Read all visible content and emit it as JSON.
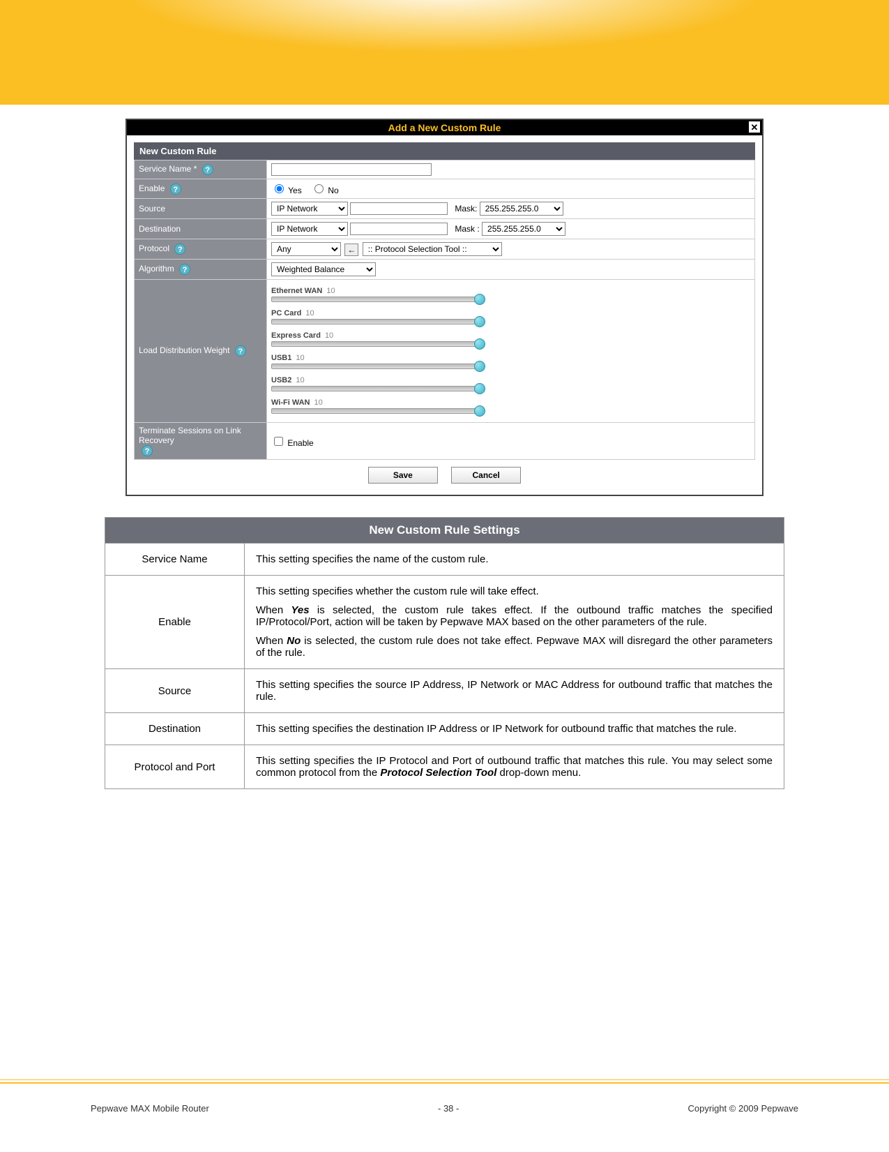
{
  "header_band": {},
  "dialog": {
    "title": "Add a New Custom Rule",
    "close_glyph": "✕",
    "section_title": "New Custom Rule",
    "rows": {
      "service_name": {
        "label": "Service Name *",
        "value": ""
      },
      "enable": {
        "label": "Enable",
        "yes": "Yes",
        "no": "No",
        "selected": "yes"
      },
      "source": {
        "label": "Source",
        "type": "IP Network",
        "addr": "",
        "mask_label": "Mask:",
        "mask": "255.255.255.0"
      },
      "destination": {
        "label": "Destination",
        "type": "IP Network",
        "addr": "",
        "mask_label": "Mask :",
        "mask": "255.255.255.0"
      },
      "protocol": {
        "label": "Protocol",
        "value": "Any",
        "arrow": "←",
        "tool": ":: Protocol Selection Tool ::"
      },
      "algorithm": {
        "label": "Algorithm",
        "value": "Weighted Balance"
      },
      "load_weight": {
        "label": "Load Distribution Weight",
        "items": [
          {
            "name": "Ethernet WAN",
            "value": "10"
          },
          {
            "name": "PC Card",
            "value": "10"
          },
          {
            "name": "Express Card",
            "value": "10"
          },
          {
            "name": "USB1",
            "value": "10"
          },
          {
            "name": "USB2",
            "value": "10"
          },
          {
            "name": "Wi-Fi WAN",
            "value": "10"
          }
        ]
      },
      "terminate": {
        "label": "Terminate Sessions on Link Recovery",
        "checkbox_label": "Enable"
      }
    },
    "buttons": {
      "save": "Save",
      "cancel": "Cancel"
    }
  },
  "settings_table": {
    "title": "New Custom Rule Settings",
    "rows": [
      {
        "key": "Service Name",
        "paras": [
          "This setting specifies the name of the custom rule."
        ]
      },
      {
        "key": "Enable",
        "paras": [
          "This setting specifies whether the custom rule will take effect.",
          "When <bi>Yes</bi> is selected, the custom rule takes effect.  If the outbound traffic matches the specified IP/Protocol/Port, action will be taken by Pepwave MAX based on the other parameters of the rule.",
          "When <bi>No</bi> is selected, the custom rule does not take effect.  Pepwave MAX will disregard the other parameters of the rule."
        ]
      },
      {
        "key": "Source",
        "paras": [
          "This setting specifies the source IP Address, IP Network or MAC Address for outbound traffic that matches the rule."
        ]
      },
      {
        "key": "Destination",
        "paras": [
          "This setting specifies the destination IP Address or IP Network for outbound traffic that matches the rule."
        ]
      },
      {
        "key": "Protocol and Port",
        "paras": [
          "This setting specifies the IP Protocol and Port of outbound traffic that matches this rule.  You may select some common protocol from the <bi>Protocol Selection Tool</bi> drop-down menu."
        ]
      }
    ]
  },
  "footer": {
    "left": "Pepwave MAX Mobile Router",
    "center": "- 38 -",
    "right": "Copyright © 2009 Pepwave"
  }
}
